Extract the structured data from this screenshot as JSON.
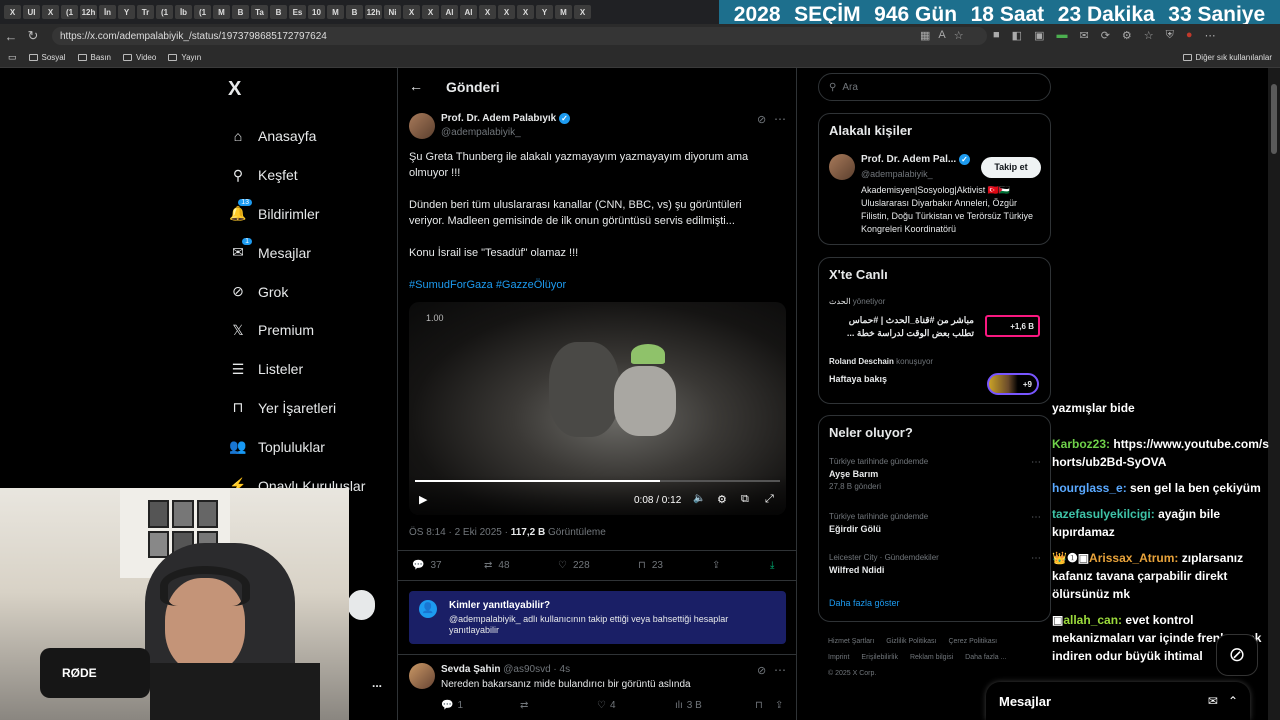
{
  "browser": {
    "url": "https://x.com/adempalabiyik_/status/1973798685172797624",
    "bookmarks": [
      "Sosyal",
      "Basın",
      "Video",
      "Yayın"
    ],
    "bookmarks_right": "Diğer sık kullanılanlar",
    "tabs": [
      "X",
      "UI",
      "X",
      "(1",
      "12h",
      "İn",
      "Y",
      "Tr",
      "(1",
      "İb",
      "(1",
      "M",
      "B",
      "Ta",
      "B",
      "Es",
      "10",
      "M",
      "B",
      "12h",
      "Ni",
      "X",
      "X",
      "Al",
      "Al",
      "X",
      "X",
      "X",
      "Y",
      "M",
      "X"
    ]
  },
  "countdown": {
    "year": "2028",
    "label": "SEÇİM",
    "days": "946 Gün",
    "hours": "18 Saat",
    "minutes": "23 Dakika",
    "seconds": "33 Saniye",
    "bg_color": "#1d6f8d"
  },
  "nav": {
    "logo": "X",
    "items": [
      {
        "label": "Anasayfa",
        "icon": "home-icon"
      },
      {
        "label": "Keşfet",
        "icon": "search-icon"
      },
      {
        "label": "Bildirimler",
        "icon": "bell-icon",
        "badge": "13"
      },
      {
        "label": "Mesajlar",
        "icon": "mail-icon",
        "badge": "1"
      },
      {
        "label": "Grok",
        "icon": "grok-icon"
      },
      {
        "label": "Premium",
        "icon": "x-icon"
      },
      {
        "label": "Listeler",
        "icon": "list-icon"
      },
      {
        "label": "Yer İşaretleri",
        "icon": "bookmark-icon"
      },
      {
        "label": "Topluluklar",
        "icon": "people-icon"
      },
      {
        "label": "Onaylı Kuruluşlar",
        "icon": "bolt-icon"
      }
    ],
    "more": "..."
  },
  "main": {
    "header": "Gönderi",
    "author_name": "Prof. Dr. Adem Palabıyık",
    "author_handle": "@adempalabiyik_",
    "text1": "Şu Greta Thunberg ile alakalı yazmayayım yazmayayım diyorum ama olmuyor !!!",
    "text2": "Dünden beri tüm uluslararası kanallar (CNN, BBC, vs) şu görüntüleri veriyor. Madleen gemisinde de ilk onun görüntüsü servis edilmişti...",
    "text3": "Konu İsrail ise \"Tesadüf\" olamaz !!!",
    "hashtags": "#SumudForGaza #GazzeÖlüyor",
    "video": {
      "watermark": "1.00",
      "time": "0:08 / 0:12",
      "progress": 0.67
    },
    "meta_time": "ÖS 8:14 · 2 Eki 2025 · ",
    "views": "117,2 B",
    "views_label": "Görüntüleme",
    "actions": {
      "replies": "37",
      "reposts": "48",
      "likes": "228",
      "bookmarks": "23"
    },
    "reply_notice_title": "Kimler yanıtlayabilir?",
    "reply_notice_text": "@adempalabiyik_ adlı kullanıcının takip ettiği veya bahsettiği hesaplar yanıtlayabilir",
    "reply": {
      "name": "Sevda Şahin",
      "handle": "@as90svd · 4s",
      "text": "Nereden bakarsanız mide bulandırıcı bir görüntü aslında",
      "replies": "1",
      "likes": "4",
      "views": "3 B"
    }
  },
  "right": {
    "search_placeholder": "Ara",
    "related_title": "Alakalı kişiler",
    "person_name": "Prof. Dr. Adem Pal...",
    "person_handle": "@adempalabiyik_",
    "follow_label": "Takip et",
    "bio": "Akademisyen|Sosyolog|Aktivist 🇹🇷🇵🇸 Uluslararası Diyarbakır Anneleri, Özgür Filistin, Doğu Türkistan ve Terörsüz Türkiye Kongreleri Koordinatörü",
    "live_title": "X'te Canlı",
    "live1_user": "الحدث",
    "live1_status": "yönetiyor",
    "live1_text": "مباشر من #قناة_الحدث | #حماس تطلب بعض الوقت لدراسة خطة ...",
    "live1_count": "+1,6 B",
    "live2_user": "Roland Deschain",
    "live2_status": "konuşuyor",
    "live2_text": "Haftaya bakış",
    "live2_count": "+9",
    "trends_title": "Neler oluyor?",
    "trends": [
      {
        "context": "Türkiye tarihinde gündemde",
        "name": "Ayşe Barım",
        "count": "27,8 B gönderi"
      },
      {
        "context": "Türkiye tarihinde gündemde",
        "name": "Eğirdir Gölü",
        "count": ""
      },
      {
        "context": "Leicester City · Gündemdekiler",
        "name": "Wilfred Ndidi",
        "count": ""
      }
    ],
    "show_more": "Daha fazla göster",
    "footer1": [
      "Hizmet Şartları",
      "Gizlilik Politikası",
      "Çerez Politikası"
    ],
    "footer2": [
      "Imprint",
      "Erişilebilirlik",
      "Reklam bilgisi",
      "Daha fazla ..."
    ],
    "copyright": "© 2025 X Corp."
  },
  "chat": {
    "msg0": "yazmışlar bide",
    "u1": "Karboz23:",
    "m1": "https://www.youtube.com/shorts/ub2Bd-SyOVA",
    "u2": "hourglass_e:",
    "m2": "sen gel la ben çekiyüm",
    "u3": "tazefasulyekilcigi:",
    "m3": "ayağın bile kıpırdamaz",
    "u4": "Arissax_Atrum:",
    "m4": "zıplarsanız kafanız tavana çarpabilir direkt ölürsünüz mk",
    "u5": "allah_can:",
    "m5": "evet kontrol mekanizmaları var içinde frenleyerek indiren odur büyük ihtimal"
  },
  "messages_drawer": "Mesajlar"
}
